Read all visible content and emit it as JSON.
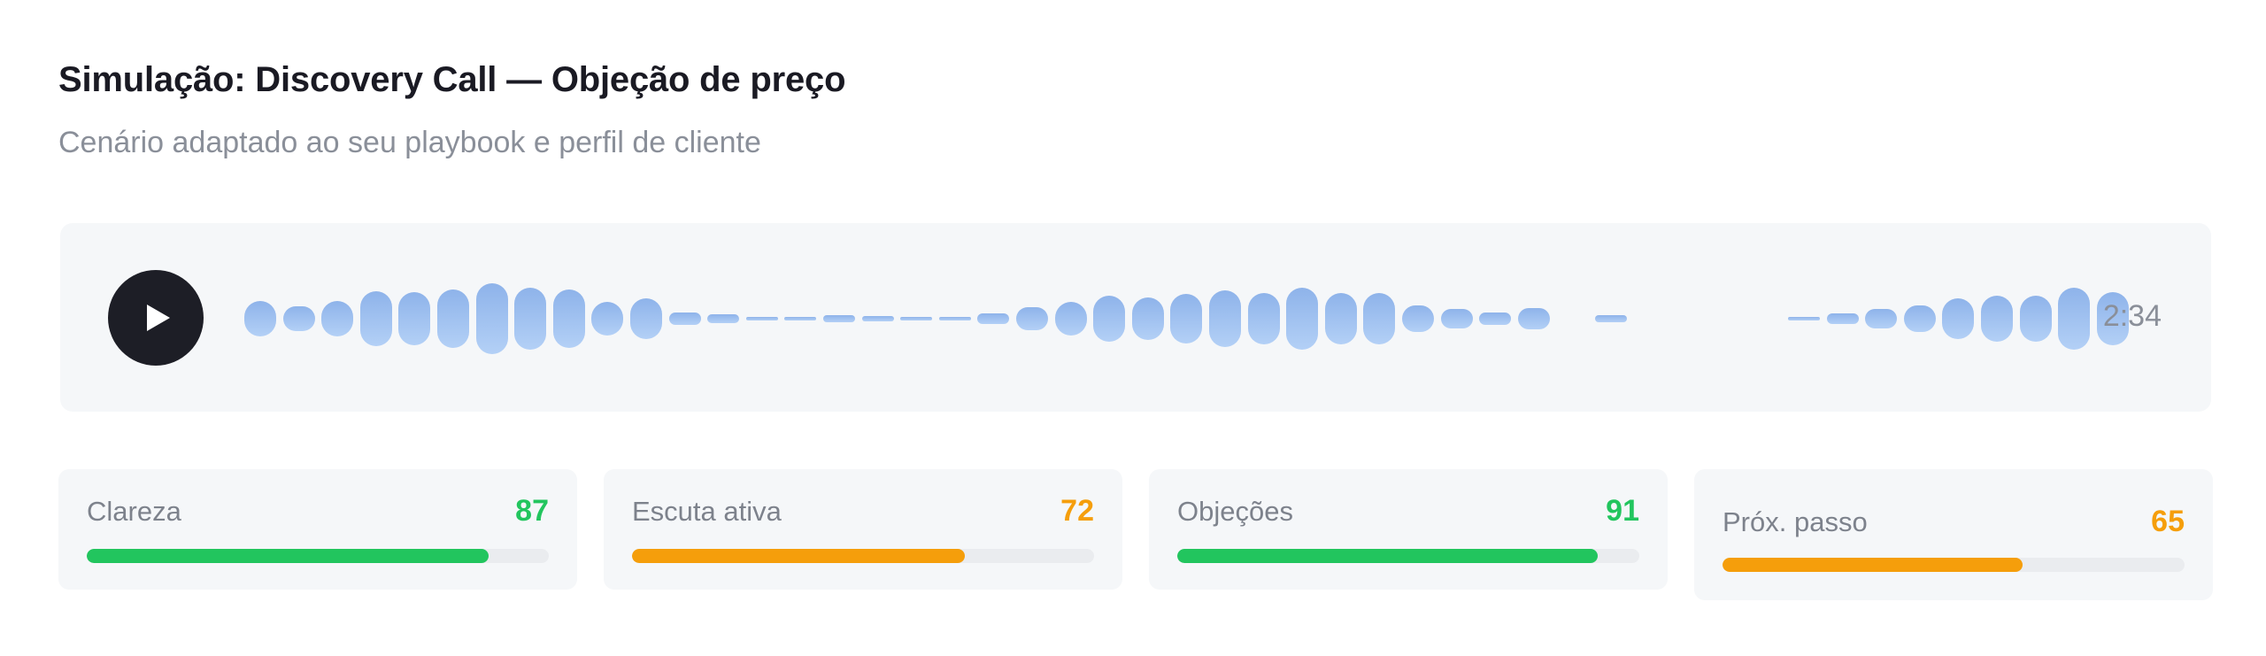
{
  "header": {
    "title": "Simulação: Discovery Call — Objeção de preço",
    "subtitle": "Cenário adaptado ao seu playbook e perfil de cliente"
  },
  "player": {
    "play_icon": "play-icon",
    "duration": "2:34",
    "colors": {
      "button": "#1d1e26",
      "wave_top": "#8eb3ea",
      "wave_bottom": "#b3d0f6"
    }
  },
  "metrics": [
    {
      "label": "Clareza",
      "value": "87",
      "progress": 0.87,
      "color": "#22c55e"
    },
    {
      "label": "Escuta ativa",
      "value": "72",
      "progress": 0.72,
      "color": "#f59e0b"
    },
    {
      "label": "Objeções",
      "value": "91",
      "progress": 0.91,
      "color": "#22c55e"
    },
    {
      "label": "Próx. passo",
      "value": "65",
      "progress": 0.65,
      "color": "#f59e0b"
    }
  ]
}
